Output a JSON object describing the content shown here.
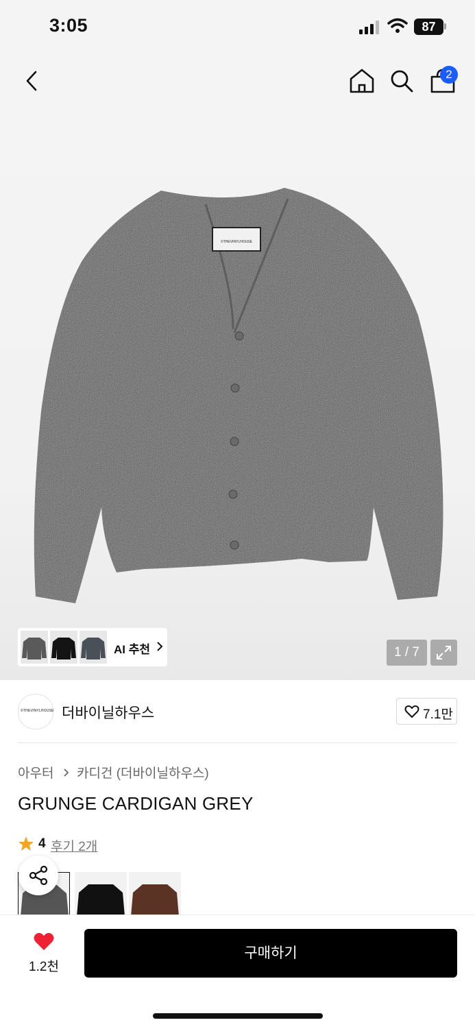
{
  "status_bar": {
    "time": "3:05",
    "battery": "87"
  },
  "header": {
    "cart_count": "2"
  },
  "hero": {
    "image_counter": "1 / 7",
    "ai_label": "AI 추천",
    "tag_text": "©THEVINYLHOUSE"
  },
  "brand": {
    "name": "더바이닐하우스",
    "likes": "7.1만",
    "logo_text": "©THEVINYLHOUSE"
  },
  "breadcrumb": {
    "category": "아우터",
    "subcategory": "카디건 (더바이닐하우스)"
  },
  "product": {
    "title": "GRUNGE CARDIGAN GREY",
    "rating": "4",
    "reviews": "후기 2개"
  },
  "swatches": [
    {
      "color": "#555555"
    },
    {
      "color": "#111111"
    },
    {
      "color": "#5a3324"
    }
  ],
  "bottom_bar": {
    "wish_count": "1.2천",
    "buy_label": "구매하기"
  },
  "colors": {
    "accent": "#1a5cff",
    "heart": "#ee2233",
    "star": "#f5a623"
  }
}
